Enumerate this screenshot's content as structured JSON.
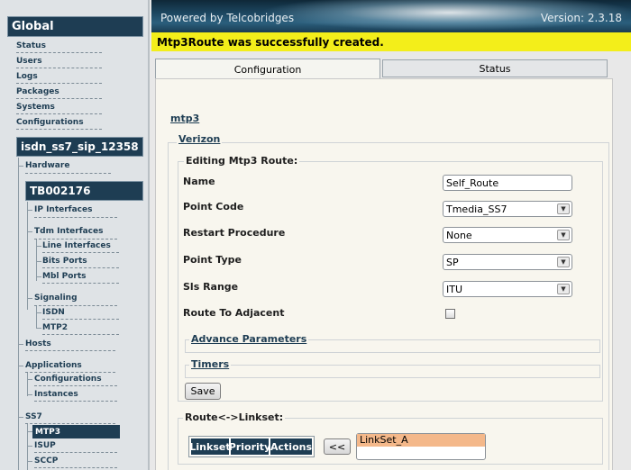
{
  "header": {
    "powered_by": "Powered by Telcobridges",
    "version": "Version: 2.3.18"
  },
  "banner": {
    "message": "Mtp3Route was successfully created."
  },
  "tabs": [
    {
      "label": "Configuration",
      "active": true
    },
    {
      "label": "Status",
      "active": false
    }
  ],
  "sidebar": {
    "global_title": "Global",
    "global_links": [
      "Status",
      "Users",
      "Logs",
      "Packages",
      "Systems",
      "Configurations"
    ],
    "config_title": "isdn_ss7_sip_12358",
    "hardware": "Hardware",
    "unit_title": "TB002176",
    "ip_interfaces": "IP Interfaces",
    "tdm_interfaces": "Tdm Interfaces",
    "line_interfaces": "Line Interfaces",
    "bits_ports": "Bits Ports",
    "mbl_ports": "Mbl Ports",
    "signaling": "Signaling",
    "isdn": "ISDN",
    "mtp2": "MTP2",
    "hosts": "Hosts",
    "applications": "Applications",
    "configurations": "Configurations",
    "instances": "Instances",
    "ss7": "SS7",
    "mtp3": "MTP3",
    "isup": "ISUP",
    "sccp": "SCCP"
  },
  "breadcrumb": {
    "level1": "mtp3",
    "level2": "Verizon"
  },
  "form": {
    "legend": "Editing Mtp3 Route:",
    "name_label": "Name",
    "name_value": "Self_Route",
    "point_code_label": "Point Code",
    "point_code_value": "Tmedia_SS7",
    "restart_label": "Restart Procedure",
    "restart_value": "None",
    "point_type_label": "Point Type",
    "point_type_value": "SP",
    "sls_label": "Sls Range",
    "sls_value": "ITU",
    "adjacent_label": "Route To Adjacent",
    "advance_params": "Advance Parameters",
    "timers": "Timers",
    "save_label": "Save"
  },
  "linkset": {
    "legend": "Route<->Linkset:",
    "columns": [
      "Linkset",
      "Priority",
      "Actions"
    ],
    "move_label": "<<",
    "available": [
      "LinkSet_A"
    ]
  }
}
